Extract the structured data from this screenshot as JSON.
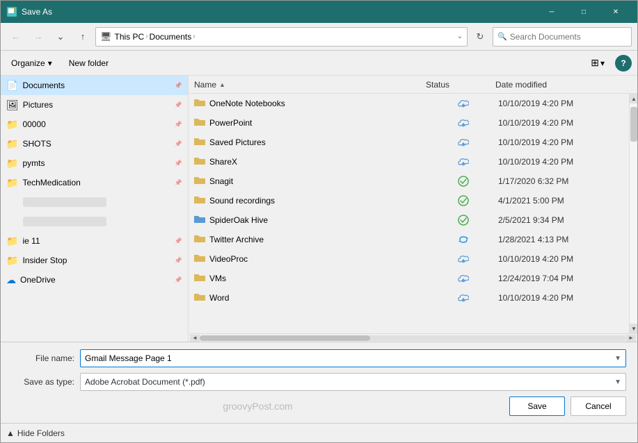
{
  "titlebar": {
    "title": "Save As",
    "icon": "💾",
    "min_label": "─",
    "max_label": "□",
    "close_label": "✕"
  },
  "nav": {
    "back_tooltip": "Back",
    "forward_tooltip": "Forward",
    "dropdown_tooltip": "Recent locations",
    "up_tooltip": "Up",
    "address_icon": "🖥",
    "breadcrumb": [
      {
        "label": "This PC"
      },
      {
        "label": "Documents"
      }
    ],
    "refresh_label": "⟳",
    "search_placeholder": "Search Documents"
  },
  "toolbar": {
    "organize_label": "Organize",
    "new_folder_label": "New folder",
    "view_icon": "⊞",
    "view_dropdown": "▾",
    "help_label": "?"
  },
  "sidebar": {
    "items": [
      {
        "label": "Documents",
        "icon": "📄",
        "pinned": true,
        "active": true
      },
      {
        "label": "Pictures",
        "icon": "🖼",
        "pinned": true
      },
      {
        "label": "00000",
        "icon": "📁",
        "pinned": true
      },
      {
        "label": "SHOTS",
        "icon": "📁",
        "pinned": true
      },
      {
        "label": "pymts",
        "icon": "📁",
        "pinned": true
      },
      {
        "label": "TechMedication",
        "icon": "📁",
        "pinned": true
      },
      {
        "label": "",
        "icon": "",
        "blurred": true
      },
      {
        "label": "",
        "icon": "",
        "blurred": true
      },
      {
        "label": "ie 11",
        "icon": "📁",
        "pinned": false
      },
      {
        "label": "Insider Stop",
        "icon": "📁",
        "pinned": false
      },
      {
        "label": "OneDrive",
        "icon": "☁",
        "pinned": false,
        "cloud": true
      }
    ]
  },
  "file_list": {
    "columns": {
      "name": "Name",
      "status": "Status",
      "date": "Date modified",
      "sort_arrow": "▲"
    },
    "files": [
      {
        "name": "OneNote Notebooks",
        "icon": "folder",
        "status": "cloud",
        "date": "10/10/2019 4:20 PM"
      },
      {
        "name": "PowerPoint",
        "icon": "folder",
        "status": "cloud",
        "date": "10/10/2019 4:20 PM"
      },
      {
        "name": "Saved Pictures",
        "icon": "folder",
        "status": "cloud",
        "date": "10/10/2019 4:20 PM"
      },
      {
        "name": "ShareX",
        "icon": "folder",
        "status": "cloud",
        "date": "10/10/2019 4:20 PM"
      },
      {
        "name": "Snagit",
        "icon": "folder",
        "status": "ok",
        "date": "1/17/2020 6:32 PM"
      },
      {
        "name": "Sound recordings",
        "icon": "folder",
        "status": "ok",
        "date": "4/1/2021 5:00 PM"
      },
      {
        "name": "SpiderOak Hive",
        "icon": "folder-blue",
        "status": "ok",
        "date": "2/5/2021 9:34 PM"
      },
      {
        "name": "Twitter Archive",
        "icon": "folder",
        "status": "sync",
        "date": "1/28/2021 4:13 PM"
      },
      {
        "name": "VideoProc",
        "icon": "folder",
        "status": "cloud",
        "date": "10/10/2019 4:20 PM"
      },
      {
        "name": "VMs",
        "icon": "folder",
        "status": "cloud",
        "date": "12/24/2019 7:04 PM"
      },
      {
        "name": "Word",
        "icon": "folder",
        "status": "cloud",
        "date": "10/10/2019 4:20 PM"
      }
    ]
  },
  "bottom": {
    "filename_label": "File name:",
    "filename_value": "Gmail Message Page 1",
    "filetype_label": "Save as type:",
    "filetype_value": "Adobe Acrobat Document (*.pdf)",
    "watermark": "groovyPost.com",
    "save_label": "Save",
    "cancel_label": "Cancel"
  },
  "hide_folders": {
    "label": "Hide Folders",
    "arrow": "▲"
  }
}
